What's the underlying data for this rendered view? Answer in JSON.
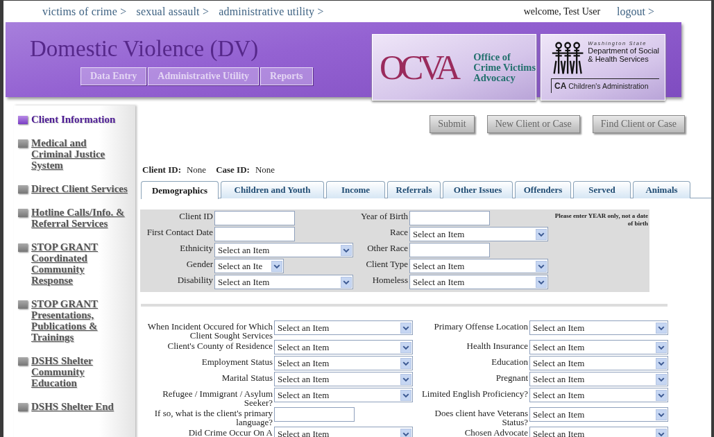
{
  "breadcrumbs": [
    {
      "label": "victims of crime >"
    },
    {
      "label": "sexual assault >"
    },
    {
      "label": "administrative utility >"
    }
  ],
  "user": {
    "welcome": "welcome, Test User",
    "logout": "logout >"
  },
  "header": {
    "title": "Domestic Violence (DV)",
    "nav": [
      "Data Entry",
      "Administrative Utility",
      "Reports"
    ]
  },
  "ocva_logo": {
    "mark": "OCVA",
    "lines": [
      "Office of",
      "Crime Victims",
      "Advocacy"
    ]
  },
  "dshs_logo": {
    "state": "Washington State",
    "lines": [
      "Department of Social",
      "& Health Services"
    ],
    "division_abbr": "CA",
    "division": "Children's Administration"
  },
  "sidebar": {
    "items": [
      {
        "label": "Client Information",
        "selected": true
      },
      {
        "label": "Medical and Criminal Justice System",
        "selected": false
      },
      {
        "label": "Direct Client Services",
        "selected": false
      },
      {
        "label": "Hotline Calls/Info. & Referral Services",
        "selected": false
      },
      {
        "label": "STOP GRANT Coordinated Community Response",
        "selected": false
      },
      {
        "label": "STOP GRANT Presentations, Publications & Trainings",
        "selected": false
      },
      {
        "label": "DSHS Shelter Community Education",
        "selected": false
      },
      {
        "label": "DSHS Shelter End",
        "selected": false
      }
    ]
  },
  "actions": [
    "Submit",
    "New Client or Case",
    "Find Client or Case"
  ],
  "ids": [
    {
      "label": "Client ID:",
      "value": "None"
    },
    {
      "label": "Case ID:",
      "value": "None"
    }
  ],
  "tabs": [
    {
      "label": "Demographics",
      "selected": true
    },
    {
      "label": "Children and Youth",
      "selected": false
    },
    {
      "label": "Income",
      "selected": false
    },
    {
      "label": "Referrals",
      "selected": false
    },
    {
      "label": "Other Issues",
      "selected": false
    },
    {
      "label": "Offenders",
      "selected": false
    },
    {
      "label": "Served",
      "selected": false
    },
    {
      "label": "Animals",
      "selected": false
    }
  ],
  "basic_section": {
    "note": "Please enter YEAR only, not a date of birth",
    "rows": [
      {
        "left": {
          "label": "Client ID",
          "kind": "text"
        },
        "right": {
          "label": "Year of Birth",
          "kind": "text"
        }
      },
      {
        "left": {
          "label": "First Contact Date",
          "kind": "text"
        },
        "right": {
          "label": "Race",
          "kind": "select",
          "value": "Select an Item"
        }
      },
      {
        "left": {
          "label": "Ethnicity",
          "kind": "select",
          "value": "Select an Item"
        },
        "right": {
          "label": "Other Race",
          "kind": "text"
        }
      },
      {
        "left": {
          "label": "Gender",
          "kind": "short_select",
          "value": "Select an Ite"
        },
        "right": {
          "label": "Client Type",
          "kind": "select",
          "value": "Select an Item"
        }
      },
      {
        "left": {
          "label": "Disability",
          "kind": "select",
          "value": "Select an Item"
        },
        "right": {
          "label": "Homeless",
          "kind": "select",
          "value": "Select an Item"
        }
      }
    ]
  },
  "detail_section": {
    "rows": [
      {
        "left": {
          "label": "When Incident Occured for Which Client Sought Services",
          "kind": "select",
          "value": "Select an Item"
        },
        "right": {
          "label": "Primary Offense Location",
          "kind": "select",
          "value": "Select an Item"
        }
      },
      {
        "left": {
          "label": "Client's County of Residence",
          "kind": "select",
          "value": "Select an Item"
        },
        "right": {
          "label": "Health Insurance",
          "kind": "select",
          "value": "Select an Item"
        }
      },
      {
        "left": {
          "label": "Employment Status",
          "kind": "select",
          "value": "Select an Item"
        },
        "right": {
          "label": "Education",
          "kind": "select",
          "value": "Select an Item"
        }
      },
      {
        "left": {
          "label": "Marital Status",
          "kind": "select",
          "value": "Select an Item"
        },
        "right": {
          "label": "Pregnant",
          "kind": "select",
          "value": "Select an Item"
        }
      },
      {
        "left": {
          "label": "Refugee / Immigrant / Asylum Seeker?",
          "kind": "select",
          "value": "Select an Item"
        },
        "right": {
          "label": "Limited English Proficiency?",
          "kind": "select",
          "value": "Select an Item"
        }
      },
      {
        "left": {
          "label": "If so, what is the client's primary language?",
          "kind": "text"
        },
        "right": {
          "label": "Does client have Veterans Status?",
          "kind": "select",
          "value": "Select an Item"
        }
      },
      {
        "left": {
          "label": "Did Crime Occur On A",
          "kind": "select",
          "value": "Select an Item"
        },
        "right": {
          "label": "Chosen Advocate",
          "kind": "select",
          "value": "Select an Item"
        }
      }
    ]
  }
}
